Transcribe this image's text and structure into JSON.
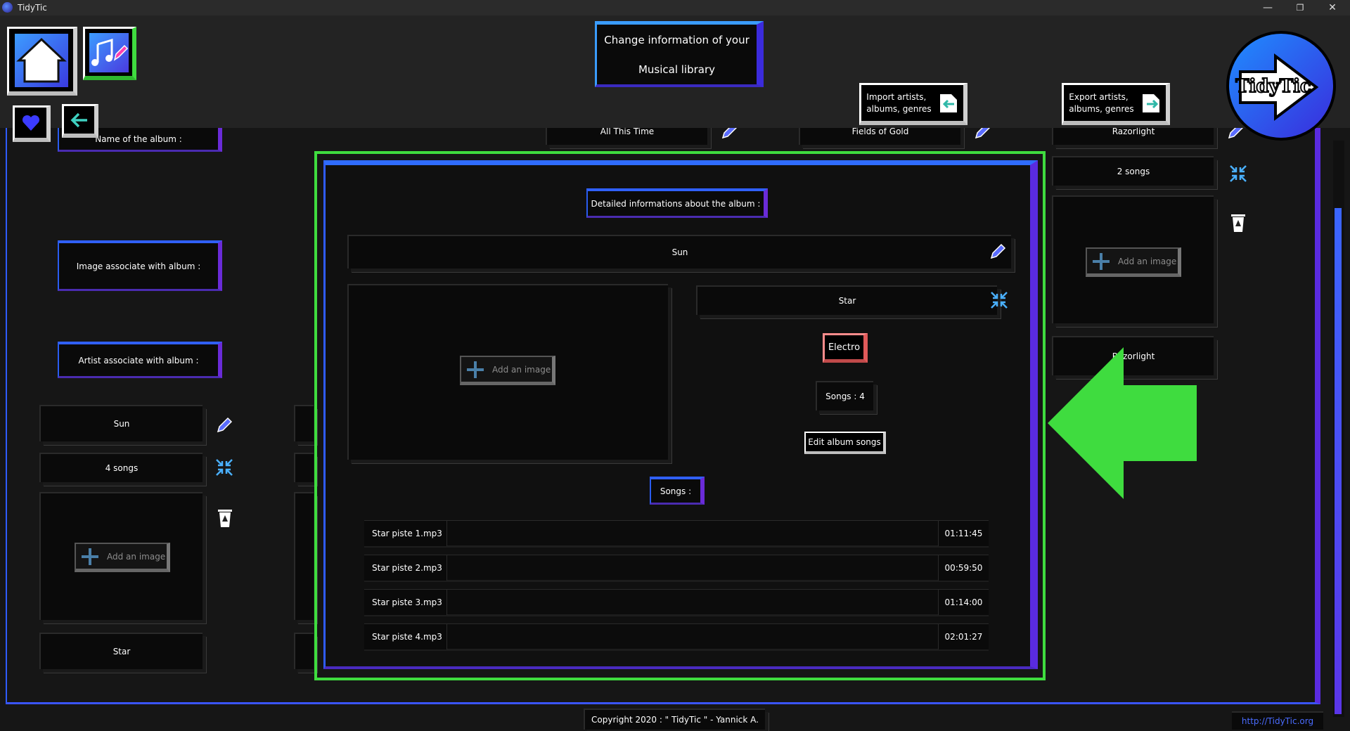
{
  "window": {
    "title": "TidyTic",
    "minimize": "—",
    "restore": "❐",
    "close": "✕"
  },
  "header": {
    "title_line1": "Change information of your",
    "title_line2": "Musical library",
    "import_line1": "Import artists,",
    "import_line2": "albums, genres",
    "export_line1": "Export artists,",
    "export_line2": "albums, genres",
    "logo_text": "TidyTic"
  },
  "left_column": {
    "name_label": "Name of the album :",
    "image_label": "Image associate with album :",
    "artist_label": "Artist associate with album :",
    "album_name": "Sun",
    "song_count": "4 songs",
    "add_image": "Add an image",
    "artist": "Star"
  },
  "top_row": {
    "album_a": "All This Time",
    "album_b": "Fields of Gold",
    "album_c": "Razorlight"
  },
  "right_column": {
    "song_count": "2 songs",
    "add_image": "Add an image",
    "artist": "Razorlight"
  },
  "detail": {
    "heading": "Detailed informations about the album :",
    "album_name": "Sun",
    "add_image": "Add an image",
    "artist": "Star",
    "genre": "Electro",
    "songs_count": "Songs  : 4",
    "edit_button": "Edit album songs",
    "songs_label": "Songs  :",
    "songs": [
      {
        "name": "Star piste 1.mp3",
        "duration": "01:11:45"
      },
      {
        "name": "Star piste 2.mp3",
        "duration": "00:59:50"
      },
      {
        "name": "Star piste 3.mp3",
        "duration": "01:14:00"
      },
      {
        "name": "Star piste 4.mp3",
        "duration": "02:01:27"
      }
    ]
  },
  "footer": {
    "copyright": "Copyright 2020 : \" TidyTic \" - Yannick A.",
    "link": "http://TidyTic.org"
  },
  "colors": {
    "highlight": "#3fdc3f",
    "accent_blue": "#2f5cff",
    "accent_purple": "#6a2bd8",
    "genre_border": "#ff6f6f"
  }
}
